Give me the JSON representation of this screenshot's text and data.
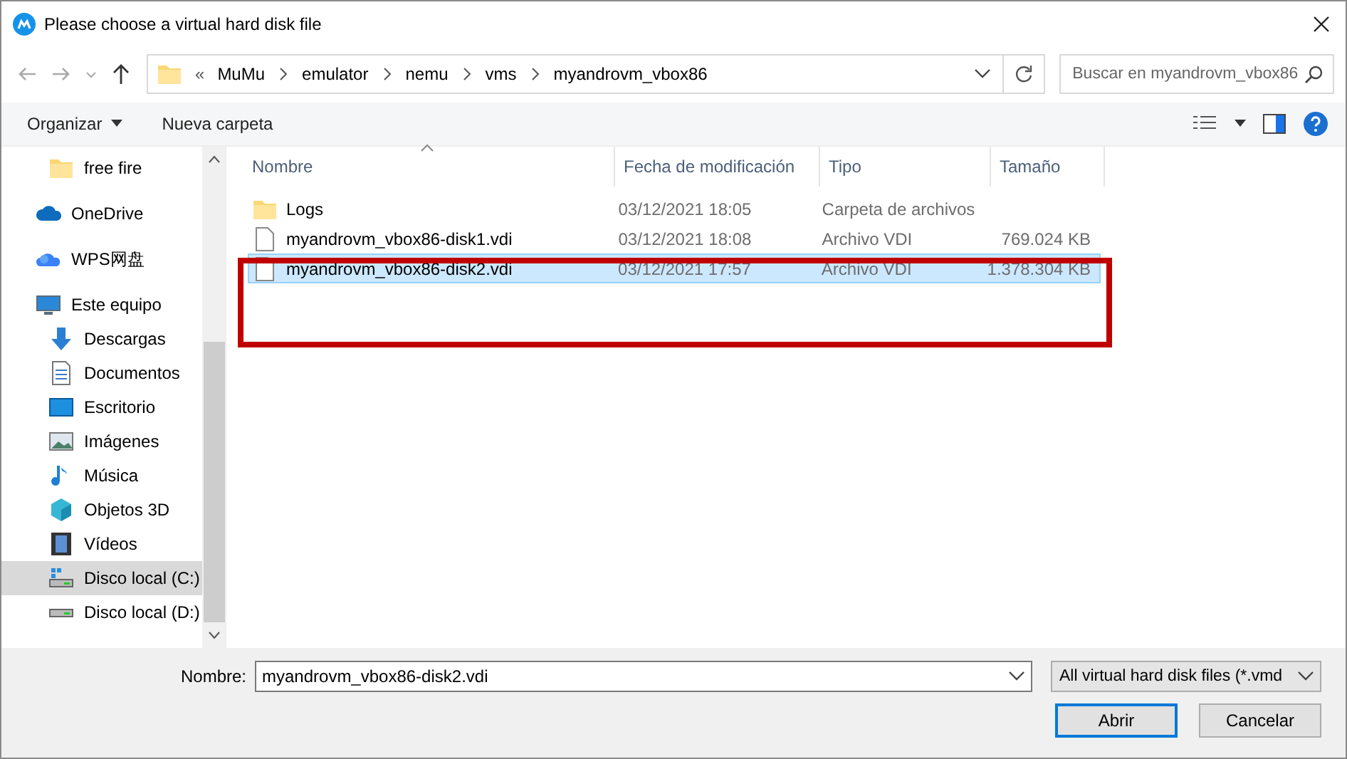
{
  "window": {
    "title": "Please choose a virtual hard disk file"
  },
  "address": {
    "segments": [
      "MuMu",
      "emulator",
      "nemu",
      "vms",
      "myandrovm_vbox86"
    ],
    "overflow": "«"
  },
  "search": {
    "placeholder": "Buscar en myandrovm_vbox86"
  },
  "toolbar": {
    "organize": "Organizar",
    "new_folder": "Nueva carpeta"
  },
  "sidebar": {
    "items": [
      {
        "label": "free fire",
        "kind": "folder",
        "selected": false
      },
      {
        "label": "OneDrive",
        "kind": "cloud",
        "selected": false
      },
      {
        "label": "WPS网盘",
        "kind": "cloud2",
        "selected": false
      },
      {
        "label": "Este equipo",
        "kind": "pc",
        "selected": false
      },
      {
        "label": "Descargas",
        "kind": "download",
        "selected": false
      },
      {
        "label": "Documentos",
        "kind": "doc",
        "selected": false
      },
      {
        "label": "Escritorio",
        "kind": "desktop",
        "selected": false
      },
      {
        "label": "Imágenes",
        "kind": "image",
        "selected": false
      },
      {
        "label": "Música",
        "kind": "music",
        "selected": false
      },
      {
        "label": "Objetos 3D",
        "kind": "cube",
        "selected": false
      },
      {
        "label": "Vídeos",
        "kind": "film",
        "selected": false
      },
      {
        "label": "Disco local (C:)",
        "kind": "drivec",
        "selected": true
      },
      {
        "label": "Disco local (D:)",
        "kind": "drive",
        "selected": false
      }
    ]
  },
  "table": {
    "columns": [
      "Nombre",
      "Fecha de modificación",
      "Tipo",
      "Tamaño"
    ],
    "rows": [
      {
        "kind": "folder",
        "name": "Logs",
        "date": "03/12/2021 18:05",
        "type": "Carpeta de archivos",
        "size": "",
        "selected": false
      },
      {
        "kind": "file",
        "name": "myandrovm_vbox86-disk1.vdi",
        "date": "03/12/2021 18:08",
        "type": "Archivo VDI",
        "size": "769.024 KB",
        "selected": false
      },
      {
        "kind": "file",
        "name": "myandrovm_vbox86-disk2.vdi",
        "date": "03/12/2021 17:57",
        "type": "Archivo VDI",
        "size": "1.378.304 KB",
        "selected": true
      }
    ]
  },
  "highlight_box": true,
  "footer": {
    "name_label": "Nombre:",
    "name_value": "myandrovm_vbox86-disk2.vdi",
    "filter": "All virtual hard disk files (*.vmd",
    "buttons": [
      "Abrir",
      "Cancelar"
    ]
  }
}
